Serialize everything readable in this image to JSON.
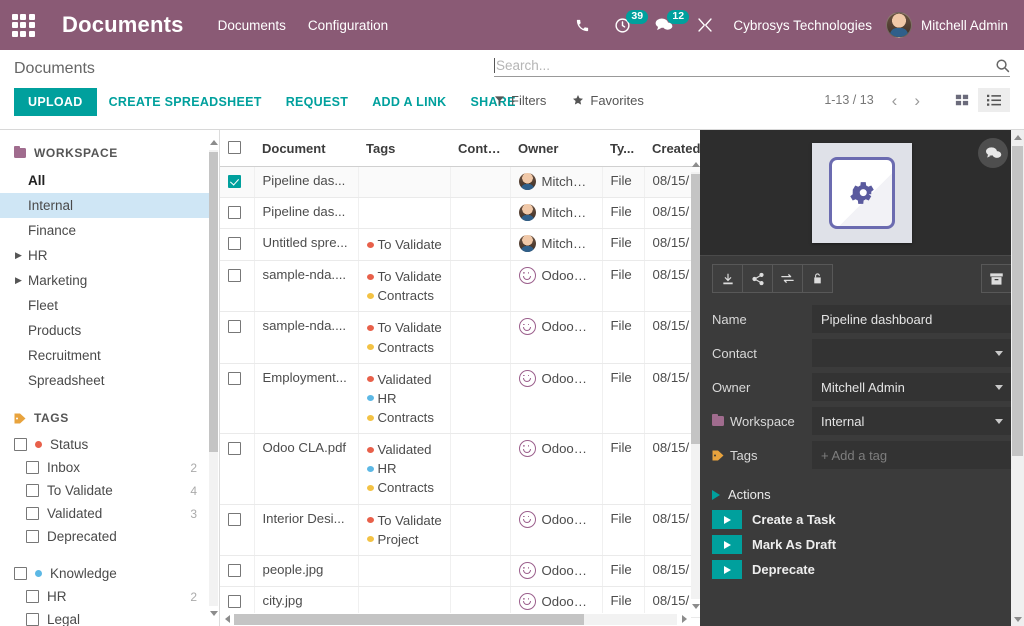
{
  "navbar": {
    "apps_icon": "apps-grid-icon",
    "brand": "Documents",
    "menu": [
      {
        "label": "Documents"
      },
      {
        "label": "Configuration"
      }
    ],
    "icons": [
      {
        "name": "phone-icon",
        "badge": null
      },
      {
        "name": "activity-clock-icon",
        "badge": "39"
      },
      {
        "name": "messages-icon",
        "badge": "12"
      },
      {
        "name": "debug-tools-icon",
        "badge": null
      }
    ],
    "company": "Cybrosys Technologies",
    "user": "Mitchell Admin",
    "bg_color": "#8a5a75"
  },
  "control_panel": {
    "title": "Documents",
    "buttons": {
      "upload": "UPLOAD",
      "create_spreadsheet": "CREATE SPREADSHEET",
      "request": "REQUEST",
      "add_a_link": "ADD A LINK",
      "share": "SHARE"
    },
    "accent_color": "#00a09d",
    "search": {
      "value": "",
      "placeholder": "Search..."
    },
    "filters_label": "Filters",
    "favorites_label": "Favorites",
    "pager": "1-13 / 13",
    "view_active": "list"
  },
  "sidebar": {
    "workspace_header": "WORKSPACE",
    "workspace_items": [
      {
        "label": "All",
        "bold": true,
        "selected": false,
        "caret": false
      },
      {
        "label": "Internal",
        "bold": false,
        "selected": true,
        "caret": false
      },
      {
        "label": "Finance",
        "bold": false,
        "selected": false,
        "caret": false
      },
      {
        "label": "HR",
        "bold": false,
        "selected": false,
        "caret": true
      },
      {
        "label": "Marketing",
        "bold": false,
        "selected": false,
        "caret": true
      },
      {
        "label": "Fleet",
        "bold": false,
        "selected": false,
        "caret": false
      },
      {
        "label": "Products",
        "bold": false,
        "selected": false,
        "caret": false
      },
      {
        "label": "Recruitment",
        "bold": false,
        "selected": false,
        "caret": false
      },
      {
        "label": "Spreadsheet",
        "bold": false,
        "selected": false,
        "caret": false
      }
    ],
    "tags_header": "TAGS",
    "tag_groups": [
      {
        "label": "Status",
        "color": "#e8604a",
        "items": [
          {
            "label": "Inbox",
            "count": "2"
          },
          {
            "label": "To Validate",
            "count": "4"
          },
          {
            "label": "Validated",
            "count": "3"
          },
          {
            "label": "Deprecated",
            "count": ""
          }
        ]
      },
      {
        "label": "Knowledge",
        "color": "#5cb8e5",
        "items": [
          {
            "label": "HR",
            "count": "2"
          },
          {
            "label": "Legal",
            "count": ""
          }
        ]
      }
    ]
  },
  "table": {
    "columns": [
      "Document",
      "Tags",
      "Contact",
      "Owner",
      "Ty...",
      "Created"
    ],
    "rows": [
      {
        "selected": true,
        "document": "Pipeline das...",
        "tags": [],
        "contact": "",
        "owner": "Mitchell...",
        "owner_avatar": "mitchell",
        "type": "File",
        "created": "08/15/"
      },
      {
        "selected": false,
        "document": "Pipeline das...",
        "tags": [],
        "contact": "",
        "owner": "Mitchell...",
        "owner_avatar": "mitchell",
        "type": "File",
        "created": "08/15/"
      },
      {
        "selected": false,
        "document": "Untitled spre...",
        "tags": [
          {
            "label": "To Validate",
            "color": "#e8604a"
          }
        ],
        "contact": "",
        "owner": "Mitchell...",
        "owner_avatar": "mitchell",
        "type": "File",
        "created": "08/15/"
      },
      {
        "selected": false,
        "document": "sample-nda....",
        "tags": [
          {
            "label": "To Validate",
            "color": "#e8604a"
          },
          {
            "label": "Contracts",
            "color": "#f3c244"
          }
        ],
        "contact": "",
        "owner": "OdooBot",
        "owner_avatar": "bot",
        "type": "File",
        "created": "08/15/"
      },
      {
        "selected": false,
        "document": "sample-nda....",
        "tags": [
          {
            "label": "To Validate",
            "color": "#e8604a"
          },
          {
            "label": "Contracts",
            "color": "#f3c244"
          }
        ],
        "contact": "",
        "owner": "OdooBot",
        "owner_avatar": "bot",
        "type": "File",
        "created": "08/15/"
      },
      {
        "selected": false,
        "document": "Employment...",
        "tags": [
          {
            "label": "Validated",
            "color": "#e8604a"
          },
          {
            "label": "HR",
            "color": "#5cb8e5"
          },
          {
            "label": "Contracts",
            "color": "#f3c244"
          }
        ],
        "contact": "",
        "owner": "OdooBot",
        "owner_avatar": "bot",
        "type": "File",
        "created": "08/15/"
      },
      {
        "selected": false,
        "document": "Odoo CLA.pdf",
        "tags": [
          {
            "label": "Validated",
            "color": "#e8604a"
          },
          {
            "label": "HR",
            "color": "#5cb8e5"
          },
          {
            "label": "Contracts",
            "color": "#f3c244"
          }
        ],
        "contact": "",
        "owner": "OdooBot",
        "owner_avatar": "bot",
        "type": "File",
        "created": "08/15/"
      },
      {
        "selected": false,
        "document": "Interior Desi...",
        "tags": [
          {
            "label": "To Validate",
            "color": "#e8604a"
          },
          {
            "label": "Project",
            "color": "#f3c244"
          }
        ],
        "contact": "",
        "owner": "OdooBot",
        "owner_avatar": "bot",
        "type": "File",
        "created": "08/15/"
      },
      {
        "selected": false,
        "document": "people.jpg",
        "tags": [],
        "contact": "",
        "owner": "OdooBot",
        "owner_avatar": "bot",
        "type": "File",
        "created": "08/15/"
      },
      {
        "selected": false,
        "document": "city.jpg",
        "tags": [],
        "contact": "",
        "owner": "OdooBot",
        "owner_avatar": "bot",
        "type": "File",
        "created": "08/15/"
      }
    ]
  },
  "detail_panel": {
    "thumbnail_icon": "gear-document-icon",
    "chat_icon": "chatter-icon",
    "toolbar": [
      {
        "name": "download-icon"
      },
      {
        "name": "share-icon"
      },
      {
        "name": "replace-icon"
      },
      {
        "name": "lock-icon"
      }
    ],
    "archive_icon": "archive-icon",
    "fields": [
      {
        "key": "name",
        "label": "Name",
        "value": "Pipeline dashboard",
        "placeholder": "",
        "type": "text",
        "icon": null
      },
      {
        "key": "contact",
        "label": "Contact",
        "value": "",
        "placeholder": "",
        "type": "select",
        "icon": null
      },
      {
        "key": "owner",
        "label": "Owner",
        "value": "Mitchell Admin",
        "placeholder": "",
        "type": "select",
        "icon": null
      },
      {
        "key": "workspace",
        "label": "Workspace",
        "value": "Internal",
        "placeholder": "",
        "type": "select",
        "icon": "folder-icon"
      },
      {
        "key": "tags",
        "label": "Tags",
        "value": "",
        "placeholder": "+ Add a tag",
        "type": "text",
        "icon": "tag-icon"
      }
    ],
    "actions_header": "Actions",
    "actions": [
      {
        "label": "Create a Task"
      },
      {
        "label": "Mark As Draft"
      },
      {
        "label": "Deprecate"
      }
    ]
  }
}
